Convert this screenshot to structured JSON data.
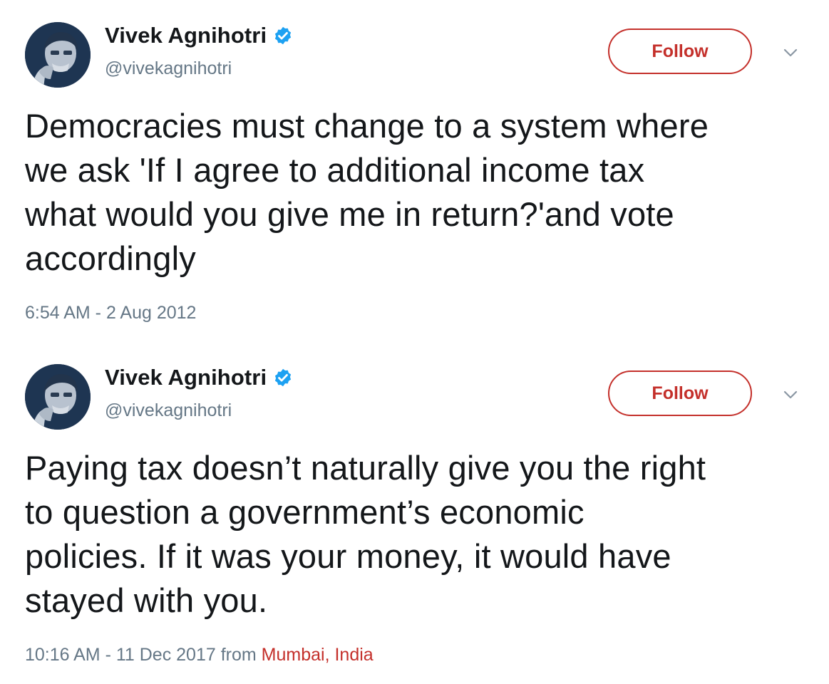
{
  "tweets": [
    {
      "name": "Vivek Agnihotri",
      "handle": "@vivekagnihotri",
      "follow_label": "Follow",
      "text": "Democracies must change to a system where\nwe ask 'If I agree to additional income tax\nwhat would you give me in return?'and vote\naccordingly",
      "timestamp": "6:54 AM - 2 Aug 2012",
      "from_label": "",
      "location": ""
    },
    {
      "name": "Vivek Agnihotri",
      "handle": "@vivekagnihotri",
      "follow_label": "Follow",
      "text": "Paying tax doesn’t naturally give you the right\nto question a government’s economic\npolicies. If it was your money, it would have\nstayed with you.",
      "timestamp": "10:16 AM - 11 Dec 2017",
      "from_label": " from ",
      "location": "Mumbai, India"
    }
  ],
  "icons": {
    "verified": "verified-badge-icon",
    "menu": "chevron-down-icon"
  },
  "colors": {
    "accent": "#c4302b",
    "verified": "#1da1f2",
    "muted": "#657786",
    "text": "#14171a"
  }
}
